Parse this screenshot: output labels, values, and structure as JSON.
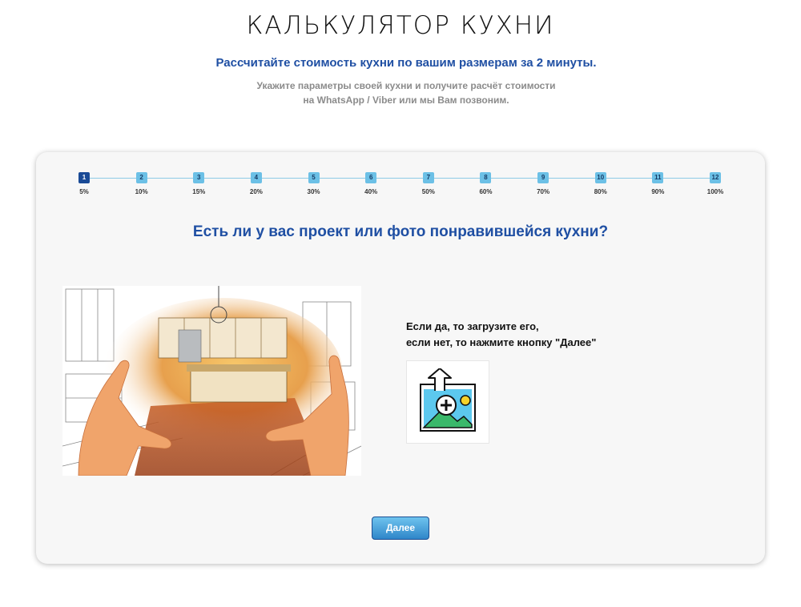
{
  "header": {
    "title": "КАЛЬКУЛЯТОР КУХНИ",
    "subtitle": "Рассчитайте стоимость кухни по вашим размерам за 2 минуты.",
    "description_line1": "Укажите параметры своей кухни и получите расчёт стоимости",
    "description_line2": "на WhatsApp / Viber или мы Вам позвоним."
  },
  "progress": {
    "current_step": 1,
    "steps": [
      {
        "label": "1",
        "percent": "5%"
      },
      {
        "label": "2",
        "percent": "10%"
      },
      {
        "label": "3",
        "percent": "15%"
      },
      {
        "label": "4",
        "percent": "20%"
      },
      {
        "label": "5",
        "percent": "30%"
      },
      {
        "label": "6",
        "percent": "40%"
      },
      {
        "label": "7",
        "percent": "50%"
      },
      {
        "label": "8",
        "percent": "60%"
      },
      {
        "label": "9",
        "percent": "70%"
      },
      {
        "label": "10",
        "percent": "80%"
      },
      {
        "label": "11",
        "percent": "90%"
      },
      {
        "label": "12",
        "percent": "100%"
      }
    ]
  },
  "question": {
    "text": "Есть ли у вас проект или фото понравившейся кухни?"
  },
  "upload": {
    "instruction_line1": "Если да, то загрузите его,",
    "instruction_line2": "если нет, то нажмите кнопку \"Далее\"",
    "icon": "image-upload-icon"
  },
  "actions": {
    "next_label": "Далее"
  },
  "colors": {
    "accent": "#1f4fa3",
    "step_inactive": "#6cc0e6",
    "step_active": "#1a4a96",
    "button": "#2f86c9"
  }
}
